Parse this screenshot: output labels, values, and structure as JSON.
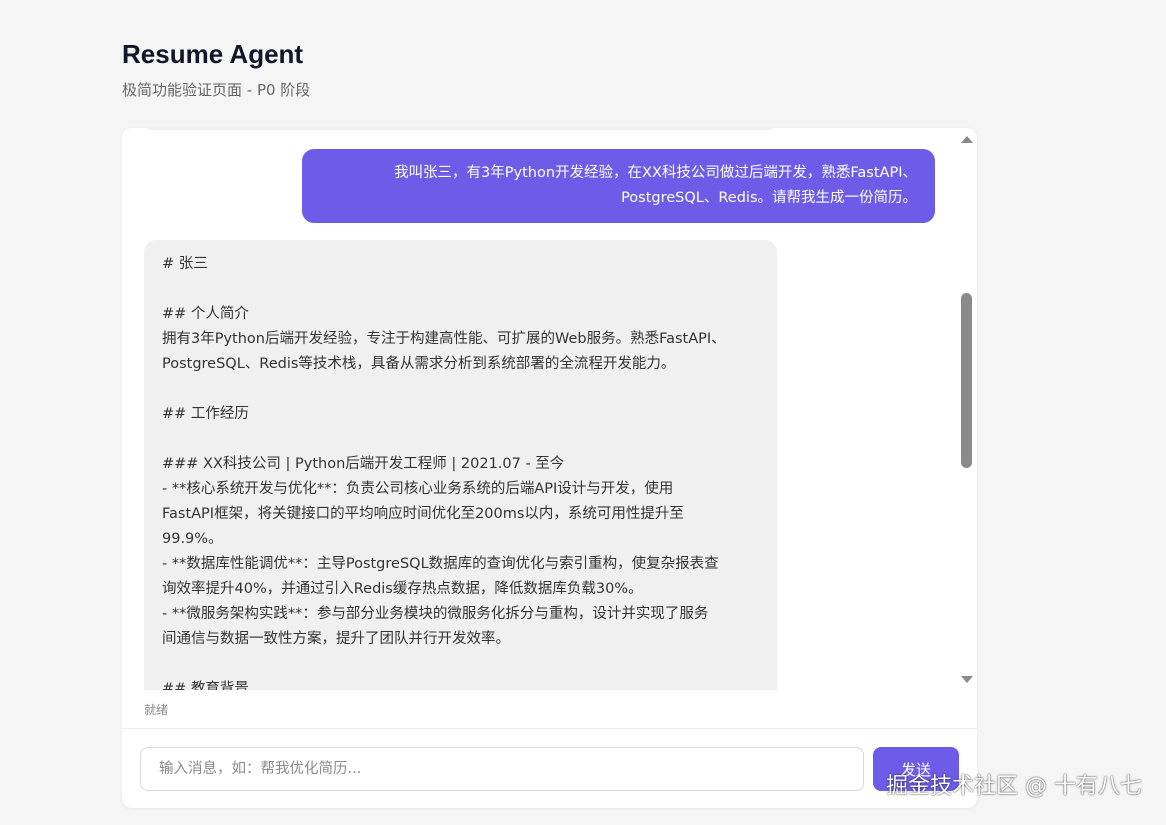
{
  "header": {
    "title": "Resume Agent",
    "subtitle": "极简功能验证页面 - P0 阶段"
  },
  "messages": {
    "user": {
      "lines": [
        "我叫张三，有3年Python开发经验，在XX科技公司做过后端开发，熟悉FastAPI、",
        "PostgreSQL、Redis。请帮我生成一份简历。"
      ]
    },
    "assistant": {
      "lines": [
        "# 张三",
        "",
        "## 个人简介",
        "拥有3年Python后端开发经验，专注于构建高性能、可扩展的Web服务。熟悉FastAPI、",
        "PostgreSQL、Redis等技术栈，具备从需求分析到系统部署的全流程开发能力。",
        "",
        "## 工作经历",
        "",
        "### XX科技公司 | Python后端开发工程师 | 2021.07 - 至今",
        "- **核心系统开发与优化**：负责公司核心业务系统的后端API设计与开发，使用",
        "FastAPI框架，将关键接口的平均响应时间优化至200ms以内，系统可用性提升至",
        "99.9%。",
        "- **数据库性能调优**：主导PostgreSQL数据库的查询优化与索引重构，使复杂报表查",
        "询效率提升40%，并通过引入Redis缓存热点数据，降低数据库负载30%。",
        "- **微服务架构实践**：参与部分业务模块的微服务化拆分与重构，设计并实现了服务",
        "间通信与数据一致性方案，提升了团队并行开发效率。",
        "",
        "## 教育背景"
      ]
    }
  },
  "status": {
    "text": "就绪"
  },
  "composer": {
    "placeholder": "输入消息，如：帮我优化简历...",
    "send_label": "发送"
  },
  "watermark": {
    "text": "掘金技术社区 @ 十有八七"
  },
  "colors": {
    "accent": "#6c5ce7",
    "assistant_bubble": "#f0f0f0",
    "background": "#f5f5f5"
  }
}
